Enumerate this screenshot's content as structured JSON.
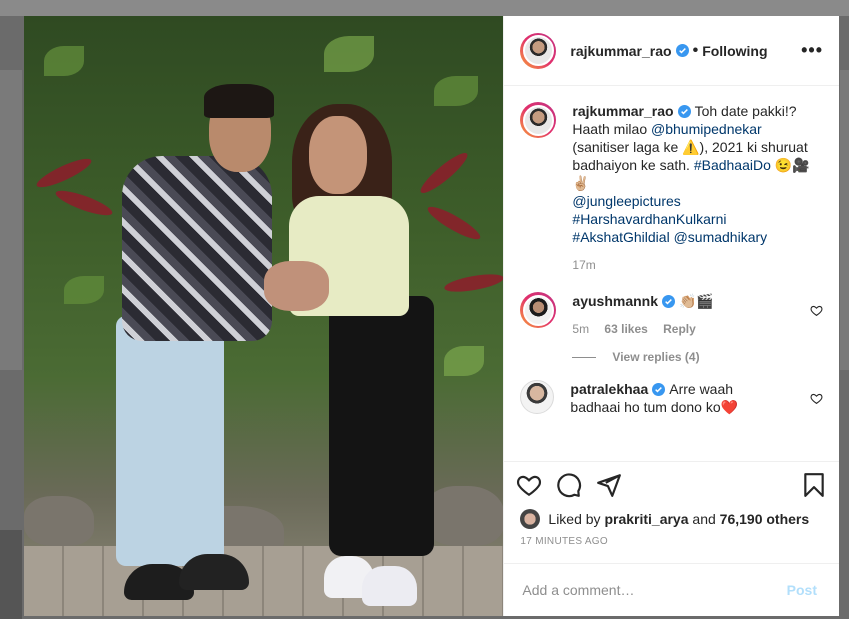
{
  "colors": {
    "accent": "#0095f6",
    "link": "#00376b",
    "muted": "#8e8e8e",
    "verified": "#3897f0"
  },
  "header": {
    "username": "rajkummar_rao",
    "separator": "•",
    "follow_state": "Following",
    "more": "•••"
  },
  "caption": {
    "username": "rajkummar_rao",
    "line1": "Toh date pakki!?",
    "line2_text": "Haath milao ",
    "line2_mention": "@bhumipednekar",
    "line3": "(sanitiser laga ke ⚠️), 2021 ki shuruat",
    "line4_text": "badhaiyon ke sath. ",
    "line4_tag": "#BadhaaiDo",
    "line4_emoji": " 😉🎥",
    "line5": "✌🏼",
    "mention1": "@jungleepictures",
    "tag1": "#HarshavardhanKulkarni",
    "tag2": "#AkshatGhildial",
    "mention2": "@sumadhikary",
    "age": "17m"
  },
  "comments": [
    {
      "username": "ayushmannk",
      "text": "👏🏼🎬",
      "age": "5m",
      "likes": "63 likes",
      "reply": "Reply"
    },
    {
      "username": "patralekhaa",
      "text1": "Arre waah",
      "text2": "badhaai ho tum dono ko❤️"
    }
  ],
  "view_replies": "View replies (4)",
  "icons": [
    "heart-icon",
    "comment-icon",
    "share-icon",
    "bookmark-icon",
    "more-icon",
    "verified-icon"
  ],
  "likes": {
    "prefix": "Liked by ",
    "user": "prakriti_arya",
    "middle": " and ",
    "count": "76,190 others"
  },
  "timestamp": "17 MINUTES AGO",
  "add_comment": {
    "placeholder": "Add a comment…",
    "post_label": "Post"
  }
}
